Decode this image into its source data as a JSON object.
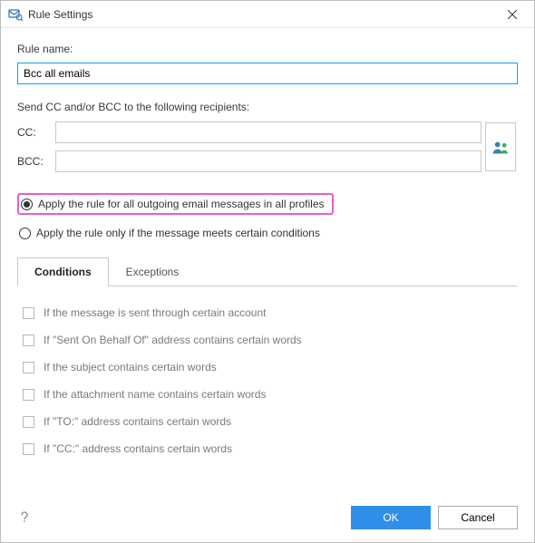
{
  "window": {
    "title": "Rule Settings"
  },
  "ruleName": {
    "label": "Rule name:",
    "value": "Bcc all emails"
  },
  "recipients": {
    "heading": "Send CC and/or BCC to the following recipients:",
    "cc_label": "CC:",
    "cc_value": "",
    "bcc_label": "BCC:",
    "bcc_value": ""
  },
  "scope": {
    "options": [
      {
        "label": "Apply the rule for all outgoing email messages in all profiles",
        "selected": true
      },
      {
        "label": "Apply the rule only if the message meets certain conditions",
        "selected": false
      }
    ]
  },
  "tabs": {
    "items": [
      {
        "label": "Conditions",
        "active": true
      },
      {
        "label": "Exceptions",
        "active": false
      }
    ]
  },
  "conditions": [
    {
      "label": "If the message is sent through certain account",
      "checked": false
    },
    {
      "label": "If \"Sent On Behalf Of\" address contains certain words",
      "checked": false
    },
    {
      "label": "If the subject contains certain words",
      "checked": false
    },
    {
      "label": "If the attachment name contains certain words",
      "checked": false
    },
    {
      "label": "If \"TO:\" address contains certain words",
      "checked": false
    },
    {
      "label": "If \"CC:\" address contains certain words",
      "checked": false
    }
  ],
  "buttons": {
    "ok": "OK",
    "cancel": "Cancel"
  }
}
